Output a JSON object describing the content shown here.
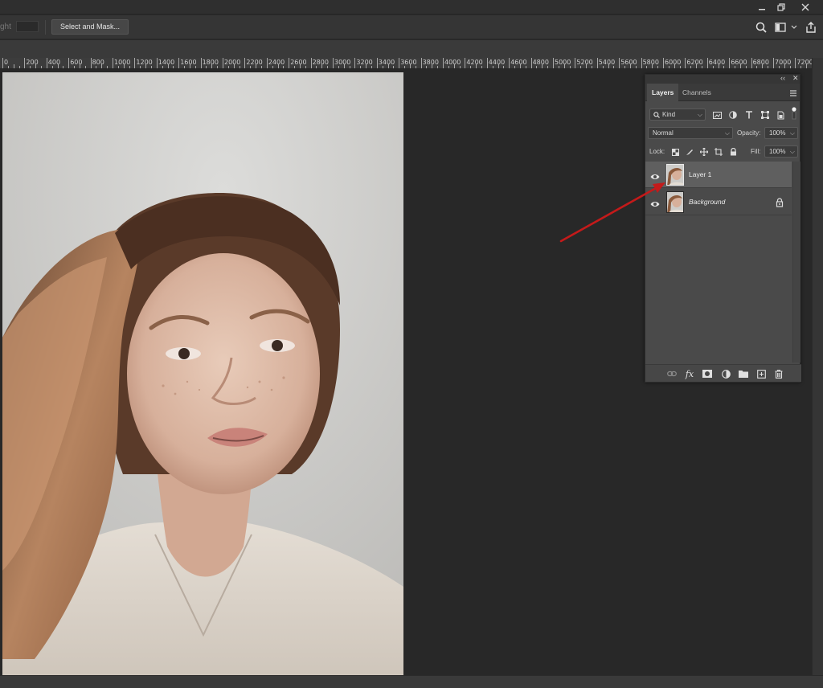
{
  "options_bar": {
    "partial_label": "ght",
    "select_mask_label": "Select and Mask..."
  },
  "ruler": {
    "labels": [
      "0",
      "200",
      "400",
      "600",
      "800",
      "1000",
      "1200",
      "1400",
      "1600",
      "1800",
      "2000",
      "2200",
      "2400",
      "2600",
      "2800",
      "3000",
      "3200",
      "3400",
      "3600",
      "3800",
      "4000",
      "4200",
      "4400",
      "4600",
      "4800",
      "5000",
      "5200",
      "5400",
      "5600",
      "5800",
      "6000",
      "6200",
      "6400",
      "6600",
      "6800",
      "7000",
      "7200"
    ]
  },
  "layers_panel": {
    "tabs": [
      "Layers",
      "Channels"
    ],
    "filter_kind": "Kind",
    "blend_mode": "Normal",
    "opacity_label": "Opacity:",
    "opacity_value": "100%",
    "lock_label": "Lock:",
    "fill_label": "Fill:",
    "fill_value": "100%",
    "layers": [
      {
        "name": "Layer 1",
        "selected": true,
        "locked": false,
        "italic": false
      },
      {
        "name": "Background",
        "selected": false,
        "locked": true,
        "italic": true
      }
    ],
    "bottom_icons": [
      "link-icon",
      "fx-icon",
      "mask-icon",
      "adjustment-icon",
      "folder-icon",
      "new-layer-icon",
      "trash-icon"
    ]
  },
  "colors": {
    "annotation_arrow": "#c41a1a",
    "panel_bg": "#4a4a4a",
    "canvas_bg": "#282828"
  }
}
